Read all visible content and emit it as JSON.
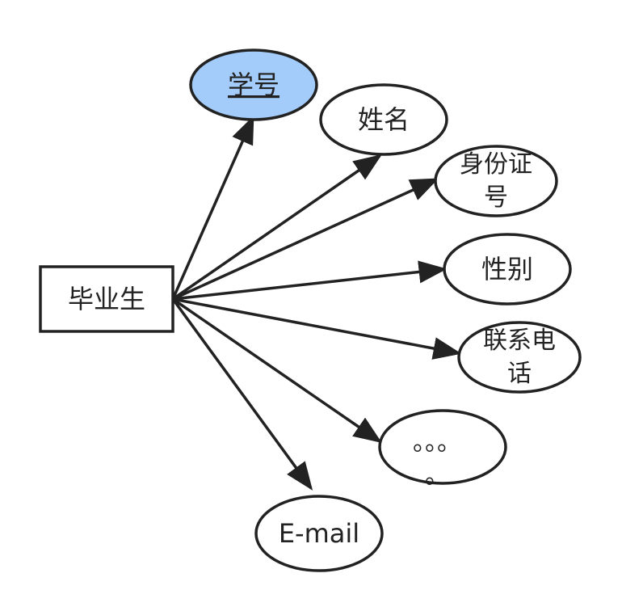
{
  "diagram": {
    "entity": {
      "label": "毕业生"
    },
    "attributes": [
      {
        "id": "student-id",
        "lines": [
          "学号"
        ],
        "primary_key": true,
        "fill": "#a3ccfb"
      },
      {
        "id": "name",
        "lines": [
          "姓名"
        ],
        "primary_key": false,
        "fill": "#ffffff"
      },
      {
        "id": "id-card",
        "lines": [
          "身份证",
          "号"
        ],
        "primary_key": false,
        "fill": "#ffffff"
      },
      {
        "id": "gender",
        "lines": [
          "性别"
        ],
        "primary_key": false,
        "fill": "#ffffff"
      },
      {
        "id": "phone",
        "lines": [
          "联系电",
          "话"
        ],
        "primary_key": false,
        "fill": "#ffffff"
      },
      {
        "id": "more",
        "lines": [
          "。。。",
          "。"
        ],
        "primary_key": false,
        "fill": "#ffffff"
      },
      {
        "id": "email",
        "lines": [
          "E-mail"
        ],
        "primary_key": false,
        "fill": "#ffffff"
      }
    ],
    "colors": {
      "stroke": "#222222",
      "key_fill": "#a3ccfb",
      "background": "#ffffff"
    }
  }
}
